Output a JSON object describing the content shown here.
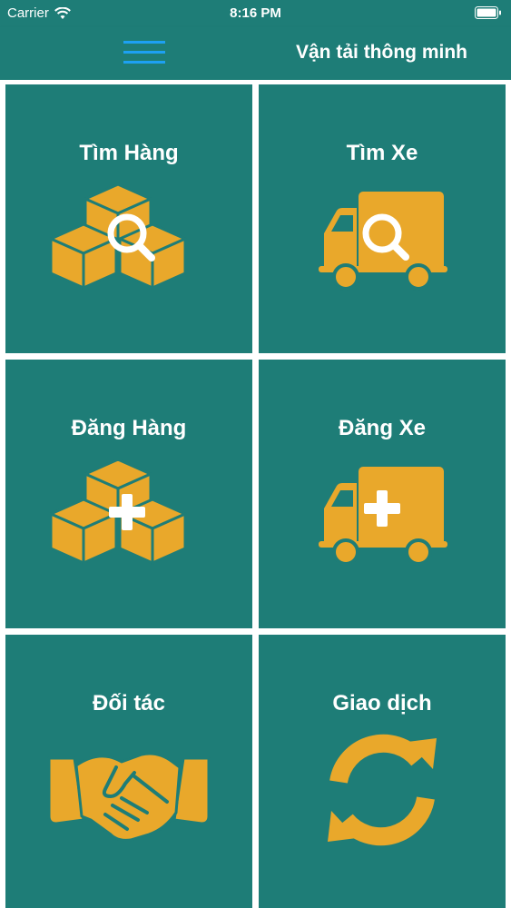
{
  "status_bar": {
    "carrier": "Carrier",
    "time": "8:16 PM"
  },
  "header": {
    "title": "Vận tải thông minh",
    "menu_icon": "hamburger-menu-icon"
  },
  "colors": {
    "primary": "#1e7d77",
    "icon": "#e9a82b",
    "menu": "#1da1f2",
    "text": "#ffffff"
  },
  "tiles": [
    {
      "label": "Tìm Hàng",
      "icon": "boxes-search-icon"
    },
    {
      "label": "Tìm Xe",
      "icon": "truck-search-icon"
    },
    {
      "label": "Đăng Hàng",
      "icon": "boxes-add-icon"
    },
    {
      "label": "Đăng Xe",
      "icon": "truck-add-icon"
    },
    {
      "label": "Đối tác",
      "icon": "handshake-icon"
    },
    {
      "label": "Giao dịch",
      "icon": "sync-icon"
    }
  ]
}
